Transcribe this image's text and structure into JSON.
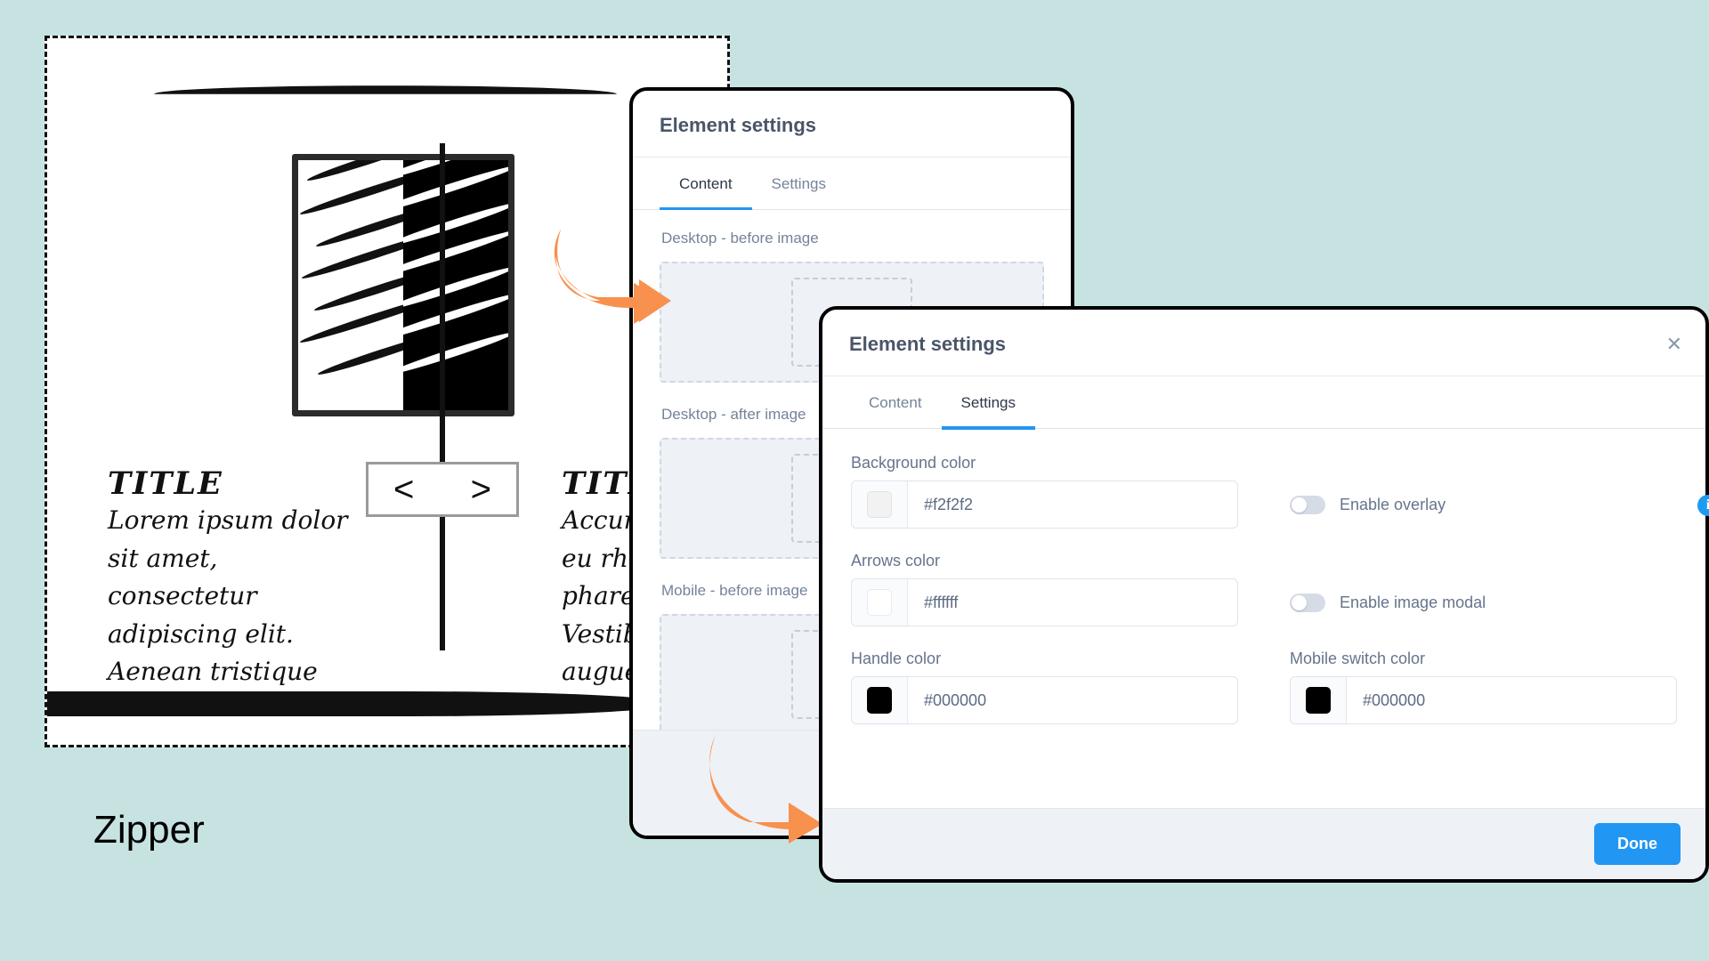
{
  "page": {
    "background_color": "#c6e3e2",
    "caption": "Zipper"
  },
  "illustration": {
    "name": "before-after-zipper-preview",
    "left_panel": {
      "title": "TITLE",
      "body": "Lorem ipsum dolor\nsit amet,\nconsectetur\nadipiscing elit.\nAenean tristique"
    },
    "right_panel": {
      "title": "TITLE",
      "body": "Accumsan\neu rhoncus\npharetra\nVestibulum\naugue, sa"
    },
    "handle": {
      "left_arrow": "<",
      "right_arrow": ">"
    }
  },
  "dialog_back": {
    "title": "Element settings",
    "tabs": [
      {
        "label": "Content",
        "active": true
      },
      {
        "label": "Settings",
        "active": false
      }
    ],
    "fields": [
      {
        "label": "Desktop - before image",
        "placeholder_icon": "image-placeholder-icon"
      },
      {
        "label": "Desktop - after image",
        "placeholder_icon": "image-placeholder-icon"
      },
      {
        "label": "Mobile - before image",
        "placeholder_icon": "image-placeholder-icon"
      }
    ]
  },
  "dialog_front": {
    "title": "Element settings",
    "close_icon": "close-icon",
    "tabs": [
      {
        "label": "Content",
        "active": false
      },
      {
        "label": "Settings",
        "active": true
      }
    ],
    "settings": {
      "background_color": {
        "label": "Background color",
        "value": "#f2f2f2",
        "swatch": "#f2f2f2"
      },
      "arrows_color": {
        "label": "Arrows color",
        "value": "#ffffff",
        "swatch": "#ffffff"
      },
      "handle_color": {
        "label": "Handle color",
        "value": "#000000",
        "swatch": "#000000"
      },
      "mobile_switch_color": {
        "label": "Mobile switch color",
        "value": "#000000",
        "swatch": "#000000"
      }
    },
    "toggles": [
      {
        "label": "Enable overlay",
        "on": false
      },
      {
        "label": "Enable image modal",
        "on": false
      }
    ],
    "info_badge": "i",
    "footer": {
      "done_label": "Done",
      "accent_color": "#2196f3"
    }
  }
}
